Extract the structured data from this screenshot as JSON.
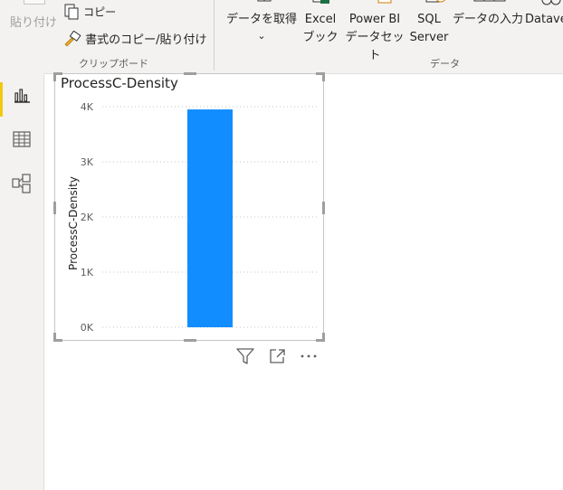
{
  "ribbon": {
    "paste": "貼り付け",
    "copy": "コピー",
    "format_painter": "書式のコピー/貼り付け",
    "clipboard_group": "クリップボード",
    "get_data": "データを取得",
    "get_data_chevron": "⌄",
    "excel_line1": "Excel",
    "excel_line2": "ブック",
    "powerbi_line1": "Power BI",
    "powerbi_line2": "データセット",
    "sql_line1": "SQL",
    "sql_line2": "Server",
    "enter_data": "データの入力",
    "dataverse": "Datave",
    "data_group": "データ"
  },
  "visual": {
    "title": "ProcessC-Density"
  },
  "chart_data": {
    "type": "bar",
    "categories": [
      ""
    ],
    "values": [
      3950
    ],
    "title": "ProcessC-Density",
    "xlabel": "",
    "ylabel": "ProcessC-Density",
    "ylim": [
      0,
      4000
    ],
    "yticks": [
      "0K",
      "1K",
      "2K",
      "3K",
      "4K"
    ],
    "grid": true,
    "bar_color": "#118dff"
  }
}
